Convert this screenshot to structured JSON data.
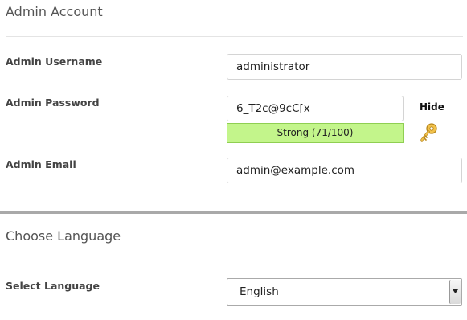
{
  "admin_account": {
    "title": "Admin Account",
    "username": {
      "label": "Admin Username",
      "value": "administrator"
    },
    "password": {
      "label": "Admin Password",
      "value": "6_T2c@9cC[x",
      "strength_text": "Strong (71/100)",
      "strength_color": "#c3f58b",
      "toggle_label": "Hide",
      "generate_icon": "key-icon"
    },
    "email": {
      "label": "Admin Email",
      "value": "admin@example.com"
    }
  },
  "choose_language": {
    "title": "Choose Language",
    "select": {
      "label": "Select Language",
      "selected": "English",
      "arrow_icon": "chevron-down-icon"
    }
  }
}
